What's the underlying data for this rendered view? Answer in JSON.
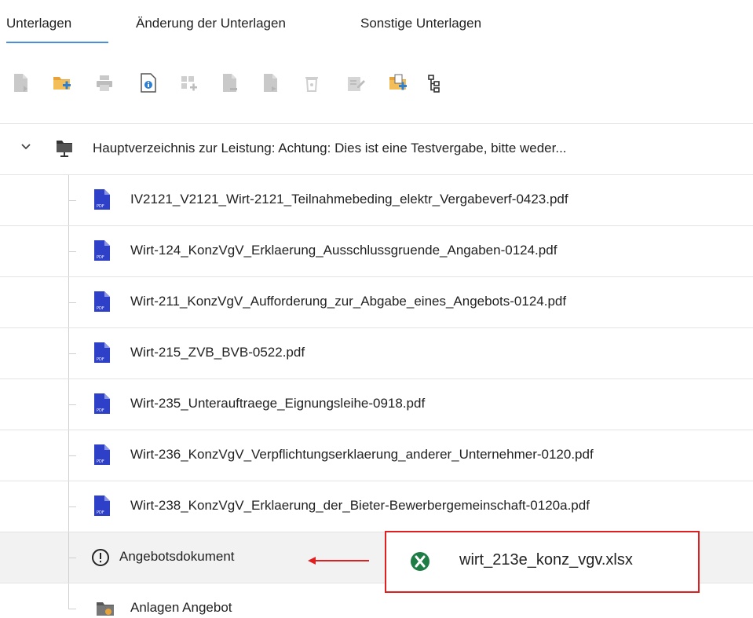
{
  "tabs": [
    {
      "label": "Unterlagen",
      "active": true
    },
    {
      "label": "Änderung der Unterlagen",
      "active": false
    },
    {
      "label": "Sonstige Unterlagen",
      "active": false
    }
  ],
  "toolbar": {
    "icons": [
      "file-upload-icon",
      "add-folder-icon",
      "print-icon",
      "info-icon",
      "grid-add-icon",
      "file-remove-icon",
      "file-move-icon",
      "delete-icon",
      "edit-icon",
      "folder-upload-icon",
      "tree-structure-icon"
    ]
  },
  "tree": {
    "root": {
      "label": "Hauptverzeichnis zur Leistung: Achtung: Dies ist eine Testvergabe, bitte weder..."
    },
    "files": [
      {
        "label": "IV2121_V2121_Wirt-2121_Teilnahmebeding_elektr_Vergabeverf-0423.pdf"
      },
      {
        "label": "Wirt-124_KonzVgV_Erklaerung_Ausschlussgruende_Angaben-0124.pdf"
      },
      {
        "label": "Wirt-211_KonzVgV_Aufforderung_zur_Abgabe_eines_Angebots-0124.pdf"
      },
      {
        "label": "Wirt-215_ZVB_BVB-0522.pdf"
      },
      {
        "label": "Wirt-235_Unterauftraege_Eignungsleihe-0918.pdf"
      },
      {
        "label": "Wirt-236_KonzVgV_Verpflichtungserklaerung_anderer_Unternehmer-0120.pdf"
      },
      {
        "label": "Wirt-238_KonzVgV_Erklaerung_der_Bieter-Bewerbergemeinschaft-0120a.pdf"
      }
    ],
    "angebot": {
      "label": "Angebotsdokument"
    },
    "anlagen": {
      "label": "Anlagen Angebot"
    }
  },
  "callout": {
    "file_name": "wirt_213e_konz_vgv.xlsx"
  },
  "colors": {
    "accent": "#4a8fd9",
    "pdf": "#2e3fc8",
    "callout_border": "#e02020",
    "excel": "#1e7d45",
    "warning": "#222222"
  }
}
